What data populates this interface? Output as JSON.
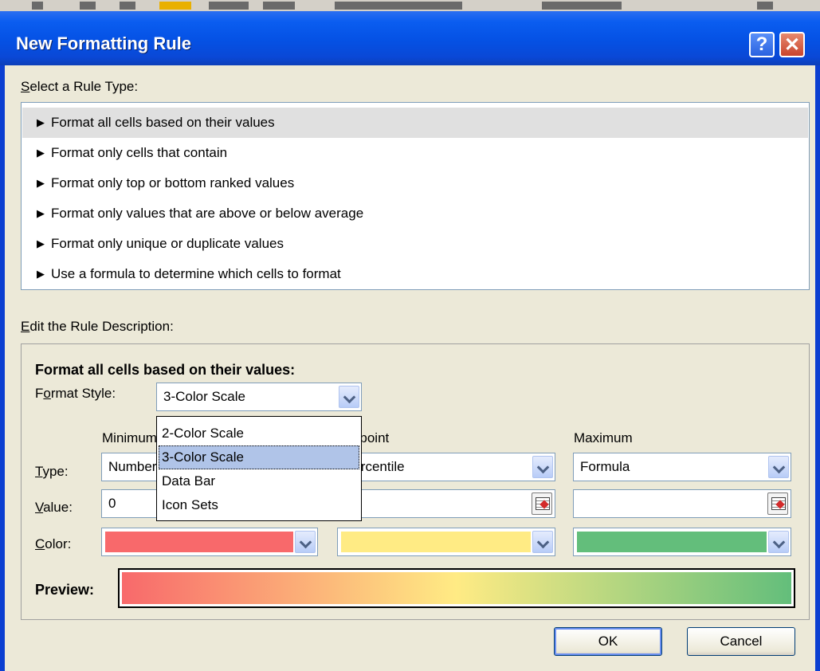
{
  "window": {
    "title": "New Formatting Rule",
    "help_glyph": "?",
    "close_glyph": "✕"
  },
  "rule_type": {
    "label_accel": "S",
    "label_rest": "elect a Rule Type:",
    "items": [
      "Format all cells based on their values",
      "Format only cells that contain",
      "Format only top or bottom ranked values",
      "Format only values that are above or below average",
      "Format only unique or duplicate values",
      "Use a formula to determine which cells to format"
    ],
    "selected_index": 0
  },
  "description": {
    "label_accel": "E",
    "label_rest": "dit the Rule Description:",
    "heading": "Format all cells based on their values:",
    "format_style_label_pre": "F",
    "format_style_label_accel": "o",
    "format_style_label_post": "rmat Style:",
    "format_style_value": "3-Color Scale",
    "format_style_options": [
      "2-Color Scale",
      "3-Color Scale",
      "Data Bar",
      "Icon Sets"
    ],
    "format_style_highlighted": "3-Color Scale"
  },
  "columns": {
    "minimum_header": "Minimum",
    "midpoint_header": "Midpoint",
    "maximum_header": "Maximum",
    "type_label_accel": "T",
    "type_label_rest": "ype:",
    "value_label_accel": "V",
    "value_label_rest": "alue:",
    "color_label_accel": "C",
    "color_label_rest": "olor:",
    "min_type": "Number",
    "mid_type": "Percentile",
    "max_type": "Formula",
    "min_value": "0",
    "mid_value": "",
    "max_value": ""
  },
  "colors": {
    "minimum": "#f8696b",
    "midpoint": "#ffeb84",
    "maximum": "#63be7b"
  },
  "preview": {
    "label": "Preview:"
  },
  "buttons": {
    "ok": "OK",
    "cancel": "Cancel"
  }
}
